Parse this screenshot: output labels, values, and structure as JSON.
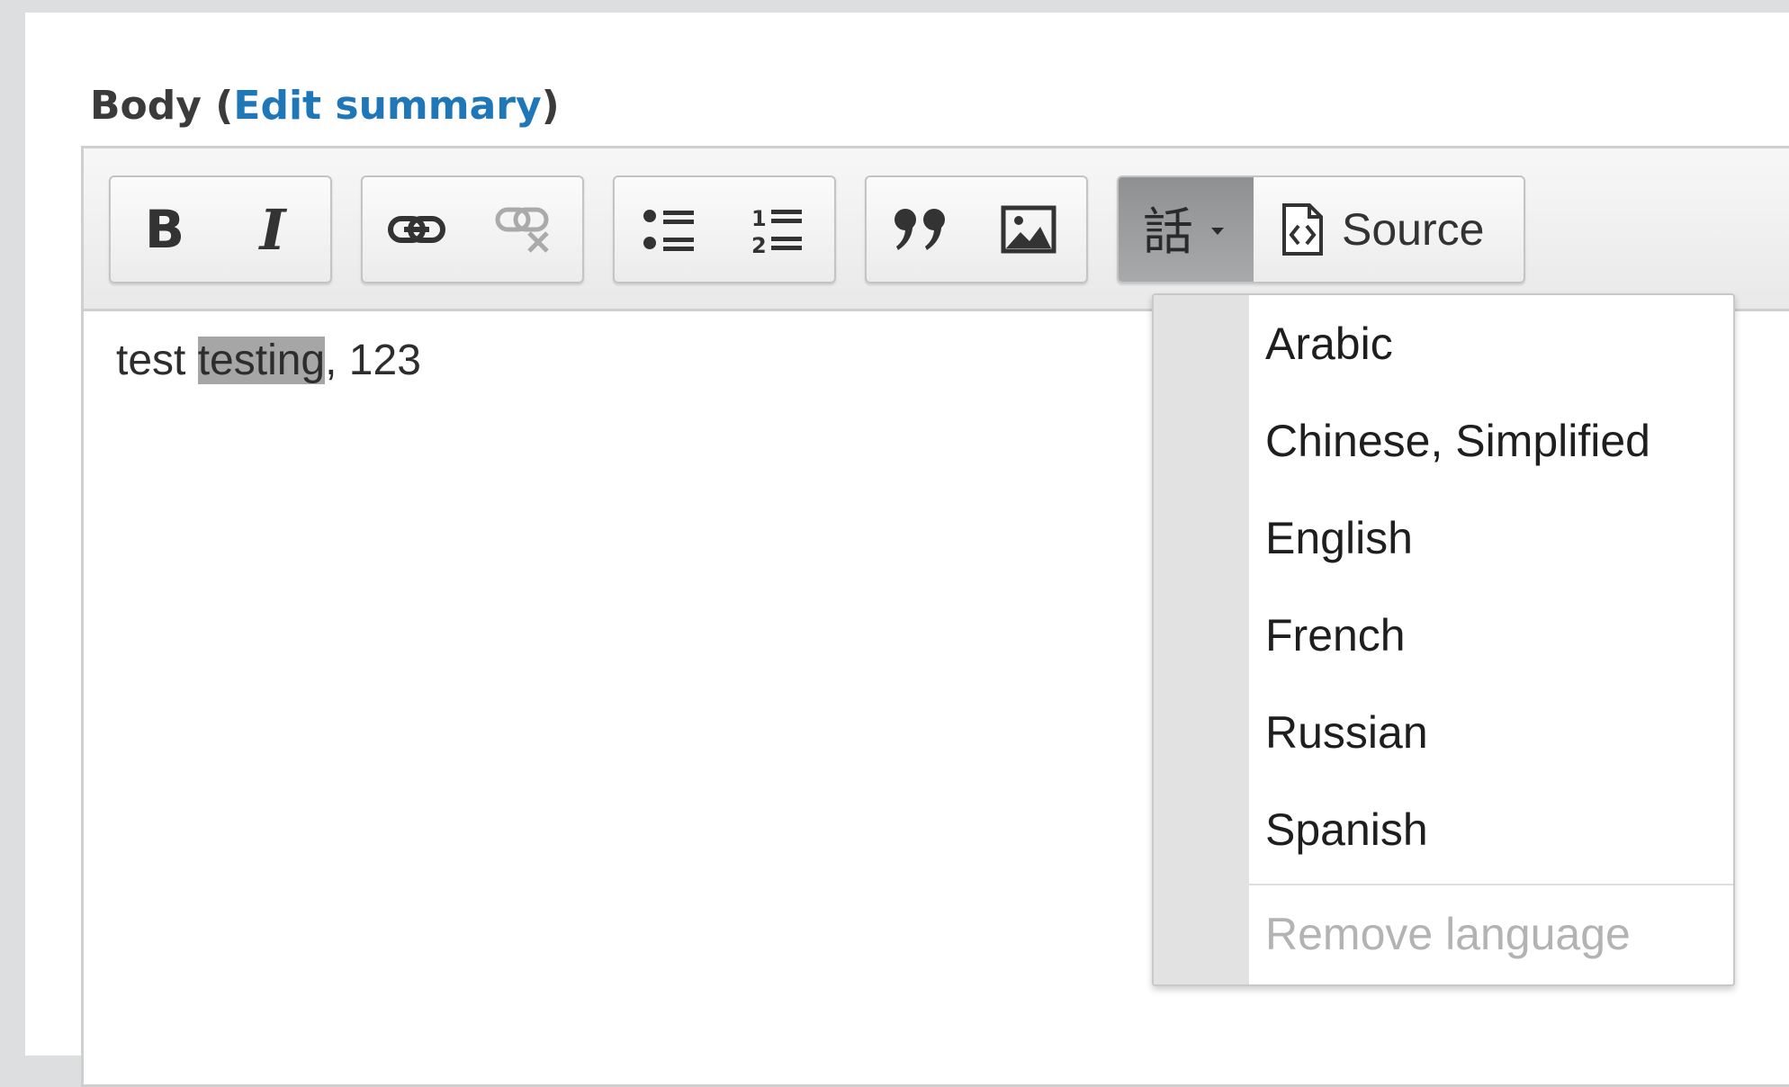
{
  "field": {
    "label": "Body",
    "open_paren": "(",
    "link": "Edit summary",
    "close_paren": ")"
  },
  "toolbar": {
    "bold": "B",
    "italic": "I",
    "link_icon": "link-icon",
    "unlink_icon": "unlink-icon",
    "bulleted_list_icon": "bulleted-list-icon",
    "numbered_list_icon": "numbered-list-icon",
    "blockquote_icon": "blockquote-icon",
    "image_icon": "image-icon",
    "language_icon": "language-icon",
    "source_label": "Source"
  },
  "editor": {
    "text_before": "test ",
    "text_selected": "testing",
    "text_after": ", 123"
  },
  "language_menu": {
    "items": [
      "Arabic",
      "Chinese, Simplified",
      "English",
      "French",
      "Russian",
      "Spanish"
    ],
    "remove_label": "Remove language"
  },
  "colors": {
    "link": "#1f77b8",
    "selection": "#a6a6a6",
    "active_button": "#9b9d9f",
    "disabled_text": "#b3b3b3"
  }
}
